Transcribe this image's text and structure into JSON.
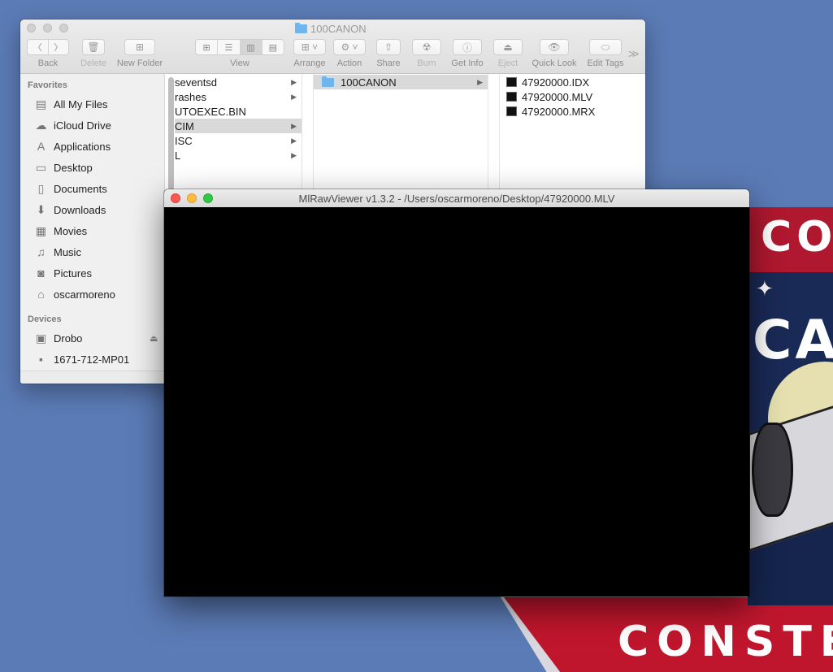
{
  "wallpaper": {
    "patch_top_text": "COM",
    "patch_mid_text": "CA",
    "patch_bottom_text": "CONSTELLA",
    "colors": {
      "red": "#b0182f",
      "navy": "#1a2a56",
      "desktop_blue": "#5b7bb6"
    }
  },
  "finder": {
    "title": "100CANON",
    "toolbar": {
      "back_label": "Back",
      "delete_label": "Delete",
      "new_folder_label": "New Folder",
      "view_label": "View",
      "arrange_label": "Arrange",
      "action_label": "Action",
      "share_label": "Share",
      "burn_label": "Burn",
      "get_info_label": "Get Info",
      "eject_label": "Eject",
      "quick_look_label": "Quick Look",
      "edit_tags_label": "Edit Tags",
      "more_label": ">>"
    },
    "sidebar": {
      "favorites_header": "Favorites",
      "favorites": [
        {
          "label": "All My Files",
          "icon": "all-files-icon"
        },
        {
          "label": "iCloud Drive",
          "icon": "cloud-icon"
        },
        {
          "label": "Applications",
          "icon": "applications-icon"
        },
        {
          "label": "Desktop",
          "icon": "desktop-icon"
        },
        {
          "label": "Documents",
          "icon": "documents-icon"
        },
        {
          "label": "Downloads",
          "icon": "downloads-icon"
        },
        {
          "label": "Movies",
          "icon": "movies-icon"
        },
        {
          "label": "Music",
          "icon": "music-icon"
        },
        {
          "label": "Pictures",
          "icon": "pictures-icon"
        },
        {
          "label": "oscarmoreno",
          "icon": "home-icon"
        }
      ],
      "devices_header": "Devices",
      "devices": [
        {
          "label": "Drobo",
          "icon": "drive-icon"
        },
        {
          "label": "1671-712-MP01",
          "icon": "disk-icon"
        }
      ]
    },
    "columns": {
      "col1": [
        "seventsd",
        "rashes",
        "UTOEXEC.BIN",
        "CIM",
        "ISC",
        "L"
      ],
      "col2": [
        "100CANON"
      ],
      "col3": [
        "47920000.IDX",
        "47920000.MLV",
        "47920000.MRX"
      ]
    }
  },
  "viewer": {
    "title": "MlRawViewer v1.3.2 - /Users/oscarmoreno/Desktop/47920000.MLV"
  }
}
